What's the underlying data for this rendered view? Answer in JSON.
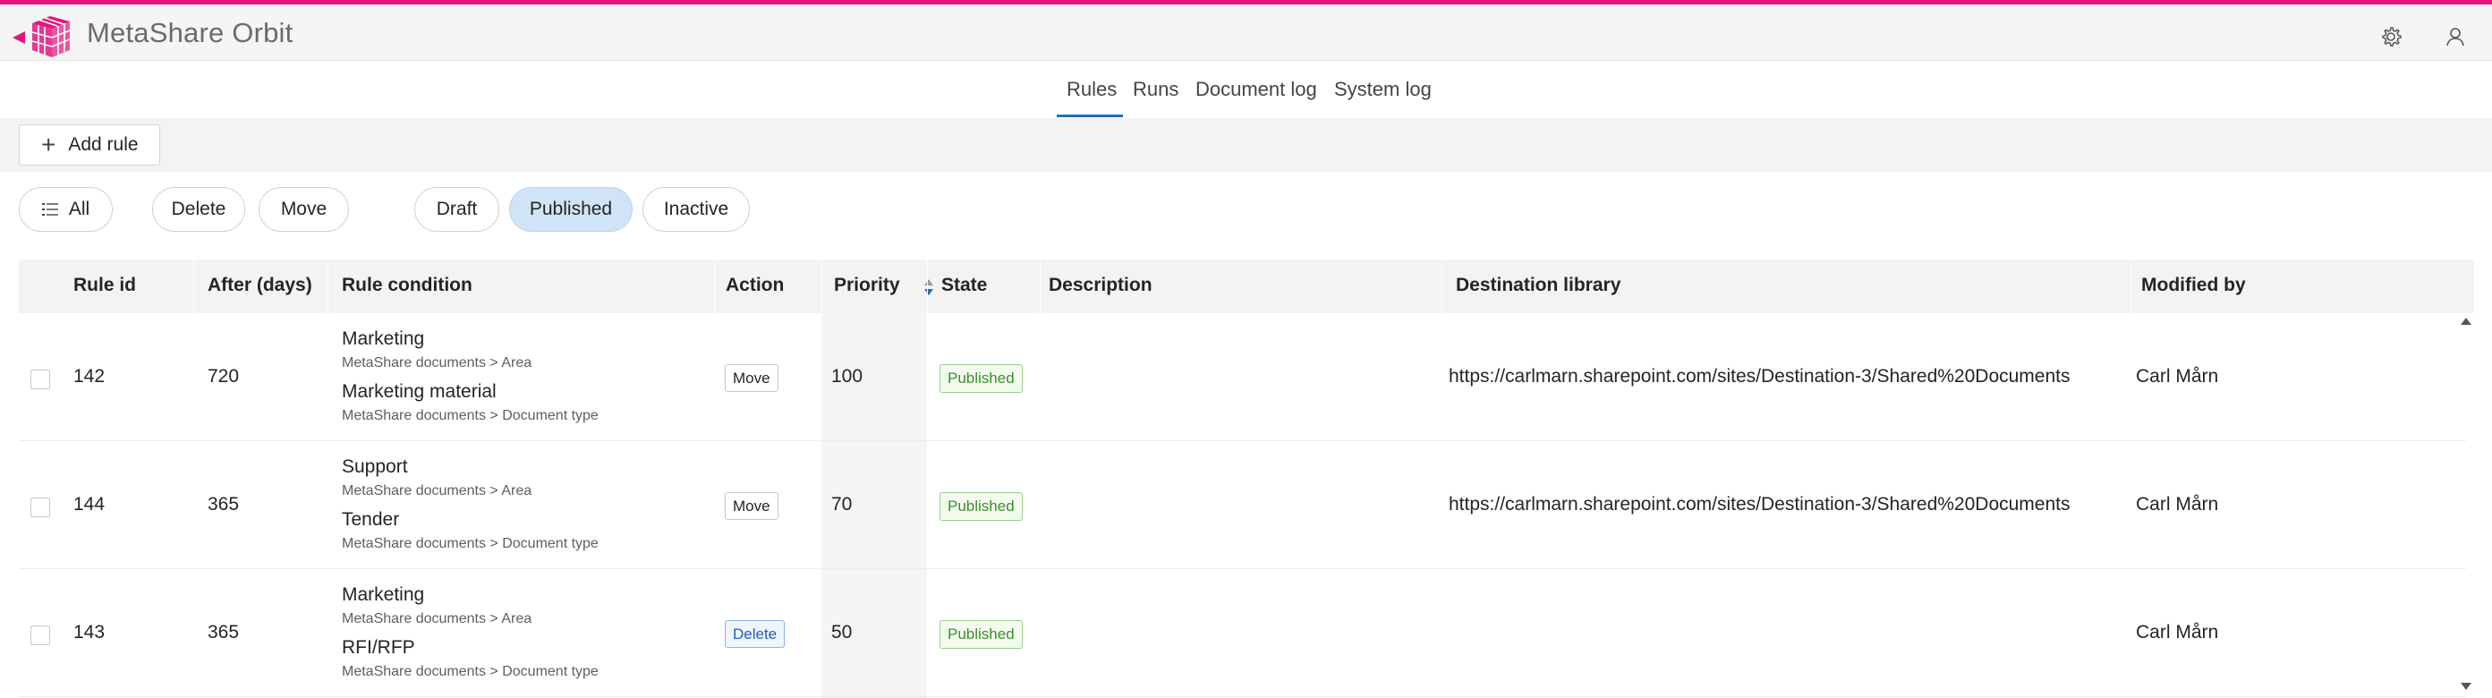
{
  "app": {
    "title": "MetaShare Orbit",
    "accent": "#e3157f",
    "icons": [
      "back-arrow-icon",
      "logo-cube-icon",
      "gear-icon",
      "user-icon"
    ]
  },
  "tabs": [
    {
      "label": "Rules",
      "active": true
    },
    {
      "label": "Runs",
      "active": false
    },
    {
      "label": "Document log",
      "active": false
    },
    {
      "label": "System log",
      "active": false
    }
  ],
  "toolbar": {
    "add_rule_label": "Add rule"
  },
  "filters": {
    "all_label": "All",
    "delete_label": "Delete",
    "move_label": "Move",
    "draft_label": "Draft",
    "published_label": "Published",
    "inactive_label": "Inactive",
    "selected": "Published"
  },
  "table": {
    "columns": [
      "Rule id",
      "After (days)",
      "Rule condition",
      "Action",
      "Priority",
      "State",
      "Description",
      "Destination library",
      "Modified by"
    ],
    "sorted_column": "Priority",
    "rows": [
      {
        "rule_id": "142",
        "after_days": "720",
        "condition1": "Marketing",
        "condition1_path": "MetaShare documents > Area",
        "condition2": "Marketing material",
        "condition2_path": "MetaShare documents > Document type",
        "action": "Move",
        "priority": "100",
        "state": "Published",
        "description": "",
        "destination": "https://carlmarn.sharepoint.com/sites/Destination-3/Shared%20Documents",
        "modified_by": "Carl Mårn"
      },
      {
        "rule_id": "144",
        "after_days": "365",
        "condition1": "Support",
        "condition1_path": "MetaShare documents > Area",
        "condition2": "Tender",
        "condition2_path": "MetaShare documents > Document type",
        "action": "Move",
        "priority": "70",
        "state": "Published",
        "description": "",
        "destination": "https://carlmarn.sharepoint.com/sites/Destination-3/Shared%20Documents",
        "modified_by": "Carl Mårn"
      },
      {
        "rule_id": "143",
        "after_days": "365",
        "condition1": "Marketing",
        "condition1_path": "MetaShare documents > Area",
        "condition2": "RFI/RFP",
        "condition2_path": "MetaShare documents > Document type",
        "action": "Delete",
        "priority": "50",
        "state": "Published",
        "description": "",
        "destination": "",
        "modified_by": "Carl Mårn"
      }
    ]
  }
}
